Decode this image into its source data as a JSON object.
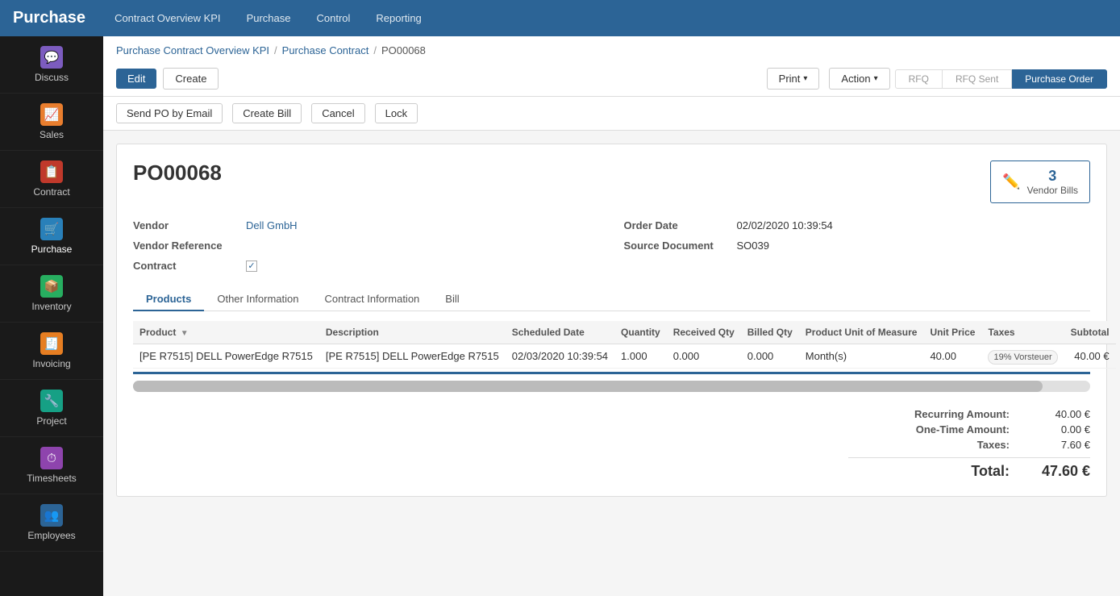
{
  "app": {
    "brand": "Purchase",
    "nav_links": [
      {
        "label": "Contract Overview KPI",
        "id": "nav-contract-overview"
      },
      {
        "label": "Purchase",
        "id": "nav-purchase"
      },
      {
        "label": "Control",
        "id": "nav-control"
      },
      {
        "label": "Reporting",
        "id": "nav-reporting"
      }
    ]
  },
  "sidebar": {
    "items": [
      {
        "label": "Discuss",
        "icon": "💬",
        "icon_class": "icon-discuss",
        "id": "discuss"
      },
      {
        "label": "Sales",
        "icon": "📈",
        "icon_class": "icon-sales",
        "id": "sales"
      },
      {
        "label": "Contract",
        "icon": "📋",
        "icon_class": "icon-contract",
        "id": "contract"
      },
      {
        "label": "Purchase",
        "icon": "🛒",
        "icon_class": "icon-purchase",
        "id": "purchase"
      },
      {
        "label": "Inventory",
        "icon": "📦",
        "icon_class": "icon-inventory",
        "id": "inventory"
      },
      {
        "label": "Invoicing",
        "icon": "🧾",
        "icon_class": "icon-invoicing",
        "id": "invoicing"
      },
      {
        "label": "Project",
        "icon": "🔧",
        "icon_class": "icon-project",
        "id": "project"
      },
      {
        "label": "Timesheets",
        "icon": "⏱",
        "icon_class": "icon-timesheets",
        "id": "timesheets"
      },
      {
        "label": "Employees",
        "icon": "👥",
        "icon_class": "icon-employees",
        "id": "employees"
      }
    ]
  },
  "breadcrumb": {
    "items": [
      {
        "label": "Purchase Contract Overview KPI",
        "id": "bc-overview"
      },
      {
        "label": "Purchase Contract",
        "id": "bc-contract"
      },
      {
        "label": "PO00068",
        "id": "bc-current"
      }
    ]
  },
  "toolbar": {
    "edit_label": "Edit",
    "create_label": "Create",
    "print_label": "Print",
    "action_label": "Action"
  },
  "sub_actions": [
    {
      "label": "Send PO by Email",
      "id": "send-po"
    },
    {
      "label": "Create Bill",
      "id": "create-bill"
    },
    {
      "label": "Cancel",
      "id": "cancel"
    },
    {
      "label": "Lock",
      "id": "lock"
    }
  ],
  "pipeline": [
    {
      "label": "RFQ",
      "id": "rfq",
      "active": false
    },
    {
      "label": "RFQ Sent",
      "id": "rfq-sent",
      "active": false
    },
    {
      "label": "Purchase Order",
      "id": "purchase-order",
      "active": true
    }
  ],
  "form": {
    "po_number": "PO00068",
    "vendor_bills_count": "3",
    "vendor_bills_label": "Vendor Bills",
    "vendor_label": "Vendor",
    "vendor_value": "Dell GmbH",
    "vendor_reference_label": "Vendor Reference",
    "contract_label": "Contract",
    "contract_checked": true,
    "order_date_label": "Order Date",
    "order_date_value": "02/02/2020 10:39:54",
    "source_document_label": "Source Document",
    "source_document_value": "SO039"
  },
  "tabs": [
    {
      "label": "Products",
      "id": "tab-products",
      "active": true
    },
    {
      "label": "Other Information",
      "id": "tab-other-info"
    },
    {
      "label": "Contract Information",
      "id": "tab-contract-info"
    },
    {
      "label": "Bill",
      "id": "tab-bill"
    }
  ],
  "table": {
    "columns": [
      {
        "label": "Product",
        "id": "col-product",
        "sortable": true
      },
      {
        "label": "Description",
        "id": "col-description"
      },
      {
        "label": "Scheduled Date",
        "id": "col-scheduled-date"
      },
      {
        "label": "Quantity",
        "id": "col-quantity"
      },
      {
        "label": "Received Qty",
        "id": "col-received-qty"
      },
      {
        "label": "Billed Qty",
        "id": "col-billed-qty"
      },
      {
        "label": "Product Unit of Measure",
        "id": "col-uom"
      },
      {
        "label": "Unit Price",
        "id": "col-unit-price"
      },
      {
        "label": "Taxes",
        "id": "col-taxes"
      },
      {
        "label": "Subtotal",
        "id": "col-subtotal"
      }
    ],
    "rows": [
      {
        "product": "[PE R7515] DELL PowerEdge R7515",
        "description": "[PE R7515] DELL PowerEdge R7515",
        "scheduled_date": "02/03/2020 10:39:54",
        "quantity": "1.000",
        "received_qty": "0.000",
        "billed_qty": "0.000",
        "uom": "Month(s)",
        "unit_price": "40.00",
        "taxes": "19% Vorsteuer",
        "subtotal": "40.00 €"
      }
    ]
  },
  "totals": {
    "recurring_amount_label": "Recurring Amount:",
    "recurring_amount_value": "40.00 €",
    "one_time_amount_label": "One-Time Amount:",
    "one_time_amount_value": "0.00 €",
    "taxes_label": "Taxes:",
    "taxes_value": "7.60 €",
    "total_label": "Total:",
    "total_value": "47.60 €"
  }
}
